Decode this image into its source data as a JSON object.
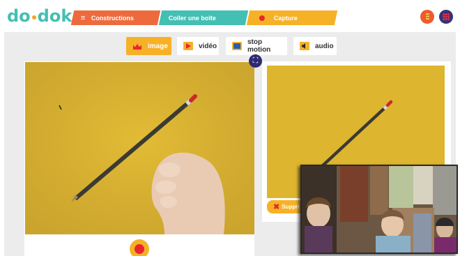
{
  "logo": {
    "text_a": "do",
    "text_b": "dok"
  },
  "tabs": [
    {
      "label": "Constructions",
      "icon": "hamburger-icon",
      "color": "#ee6a3d"
    },
    {
      "label": "Coller une boîte",
      "color": "#43bfb3"
    },
    {
      "label": "Capture",
      "icon": "record-dot-icon",
      "color": "#f6b127"
    }
  ],
  "header_buttons": [
    {
      "icon": "list-icon",
      "color": "#ee5a2e"
    },
    {
      "icon": "grid-icon",
      "color": "#3a3178"
    }
  ],
  "modes": [
    {
      "label": "image",
      "icon": "crown-image-icon",
      "active": true
    },
    {
      "label": "vidéo",
      "icon": "play-icon",
      "active": false
    },
    {
      "label": "stop motion",
      "icon": "film-frame-icon",
      "active": false
    },
    {
      "label": "audio",
      "icon": "speaker-icon",
      "active": false
    }
  ],
  "preview": {
    "delete_label": "Suppri"
  },
  "colors": {
    "accent": "#f6b127",
    "record": "#e8262d",
    "navy": "#2f2a73",
    "workspace": "#ececec"
  }
}
